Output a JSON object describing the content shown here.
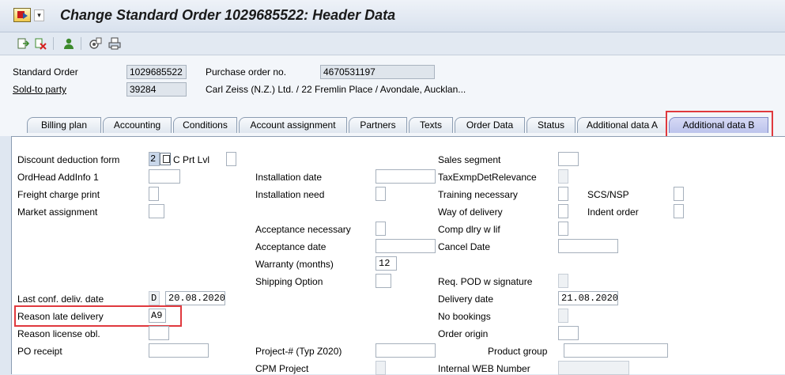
{
  "window": {
    "title": "Change Standard Order 1029685522: Header Data"
  },
  "toolbar": {
    "icons": [
      "display-other-order-icon",
      "delete-icon",
      "sold-to-party-icon",
      "document-flow-icon",
      "print-icon"
    ]
  },
  "header": {
    "order_label": "Standard Order",
    "order_value": "1029685522",
    "po_label": "Purchase order no.",
    "po_value": "4670531197",
    "sold_to_label": "Sold-to party",
    "sold_to_value": "39284",
    "sold_to_text": "Carl Zeiss (N.Z.) Ltd. / 22 Fremlin Place / Avondale, Aucklan..."
  },
  "tabs": [
    "Billing plan",
    "Accounting",
    "Conditions",
    "Account assignment",
    "Partners",
    "Texts",
    "Order Data",
    "Status",
    "Additional data A",
    "Additional data B"
  ],
  "active_tab": "Additional data B",
  "fields": {
    "discount_deduction_form": {
      "label": "Discount deduction form",
      "value": "2"
    },
    "c_prt_lvl": {
      "label": "C Prt Lvl",
      "value": ""
    },
    "ordhead_addinfo1": {
      "label": "OrdHead AddInfo 1",
      "value": ""
    },
    "freight_charge_print": {
      "label": "Freight charge print",
      "value": ""
    },
    "market_assignment": {
      "label": "Market assignment",
      "value": ""
    },
    "last_conf_deliv_date": {
      "label": "Last conf. deliv. date",
      "value": "D",
      "value2": "20.08.2020"
    },
    "reason_late_delivery": {
      "label": "Reason late delivery",
      "value": "A9"
    },
    "reason_license_obl": {
      "label": "Reason license obl.",
      "value": ""
    },
    "po_receipt": {
      "label": "PO receipt",
      "value": ""
    },
    "installation_date": {
      "label": "Installation date",
      "value": ""
    },
    "installation_need": {
      "label": "Installation need",
      "value": ""
    },
    "acceptance_necessary": {
      "label": "Acceptance necessary",
      "value": ""
    },
    "acceptance_date": {
      "label": "Acceptance date",
      "value": ""
    },
    "warranty_months": {
      "label": "Warranty (months)",
      "value": "12"
    },
    "shipping_option": {
      "label": "Shipping Option",
      "value": ""
    },
    "project_typ": {
      "label": "Project-# (Typ Z020)",
      "value": ""
    },
    "cpm_project": {
      "label": "CPM Project",
      "value": ""
    },
    "sales_segment": {
      "label": "Sales segment",
      "value": ""
    },
    "tax_exmp": {
      "label": "TaxExmpDetRelevance",
      "value": ""
    },
    "training_necessary": {
      "label": "Training necessary",
      "value": ""
    },
    "way_of_delivery": {
      "label": "Way of delivery",
      "value": ""
    },
    "comp_dlry_w_lif": {
      "label": "Comp dlry w lif",
      "value": ""
    },
    "cancel_date": {
      "label": "Cancel Date",
      "value": ""
    },
    "req_pod": {
      "label": "Req. POD w signature",
      "value": ""
    },
    "delivery_date": {
      "label": "Delivery date",
      "value": "21.08.2020"
    },
    "no_bookings": {
      "label": "No bookings",
      "value": ""
    },
    "order_origin": {
      "label": "Order origin",
      "value": ""
    },
    "internal_web_number": {
      "label": "Internal WEB Number",
      "value": ""
    },
    "scs_nsp": {
      "label": "SCS/NSP",
      "value": ""
    },
    "indent_order": {
      "label": "Indent order",
      "value": ""
    },
    "product_group": {
      "label": "Product group",
      "value": ""
    }
  },
  "colors": {
    "highlight": "#e0393e",
    "active_tab": "#bcc3ec"
  }
}
